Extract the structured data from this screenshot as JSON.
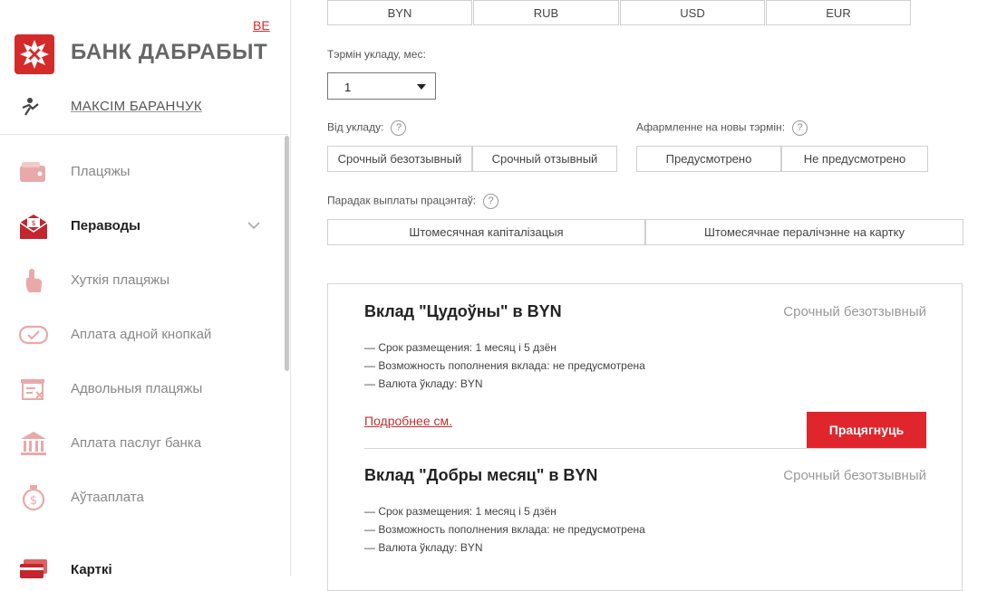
{
  "sidebar": {
    "lang": "BE",
    "bank_name": "БАНК ДАБРАБЫТ",
    "user_name": "МАКСІМ БАРАНЧУК",
    "items": [
      {
        "label": "Плацяжы",
        "icon": "wallet-icon"
      },
      {
        "label": "Пераводы",
        "icon": "envelope-money-icon"
      },
      {
        "label": "Хуткія плацяжы",
        "icon": "touch-hand-icon"
      },
      {
        "label": "Аплата адной кнопкай",
        "icon": "one-click-icon"
      },
      {
        "label": "Адвольныя плацяжы",
        "icon": "free-payment-icon"
      },
      {
        "label": "Аплата паслуг банка",
        "icon": "bank-building-icon"
      },
      {
        "label": "Аўтааплата",
        "icon": "auto-payment-icon"
      },
      {
        "label": "Карткі",
        "icon": "cards-icon"
      }
    ]
  },
  "currencies": [
    "BYN",
    "RUB",
    "USD",
    "EUR"
  ],
  "term": {
    "label": "Тэрмін укладу, мес:",
    "value": "1"
  },
  "deposit_type": {
    "label": "Від укладу:",
    "options": [
      "Срочный безотзывный",
      "Срочный отзывный"
    ]
  },
  "renewal": {
    "label": "Афармленне на новы тэрмін:",
    "options": [
      "Предусмотрено",
      "Не предусмотрено"
    ]
  },
  "interest_order": {
    "label": "Парадак выплаты працэнтаў:",
    "options": [
      "Штомесячная капіталізацыя",
      "Штомесячнае пералічэнне на картку"
    ]
  },
  "deposits": [
    {
      "title": "Вклад \"Цудоўны\" в BYN",
      "type": "Срочный безотзывный",
      "lines": [
        "— Срок размещения: 1 месяц і 5 дзён",
        "— Возможность пополнения вклада: не предусмотрена",
        "— Валюта ўкладу: BYN"
      ],
      "more": "Подробнее см.",
      "button": "Працягнуць"
    },
    {
      "title": "Вклад \"Добры месяц\" в BYN",
      "type": "Срочный безотзывный",
      "lines": [
        "— Срок размещения: 1 месяц і 5 дзён",
        "— Возможность пополнения вклада: не предусмотрена",
        "— Валюта ўкладу: BYN"
      ]
    }
  ],
  "colors": {
    "accent": "#e0252c",
    "link": "#c03030"
  }
}
